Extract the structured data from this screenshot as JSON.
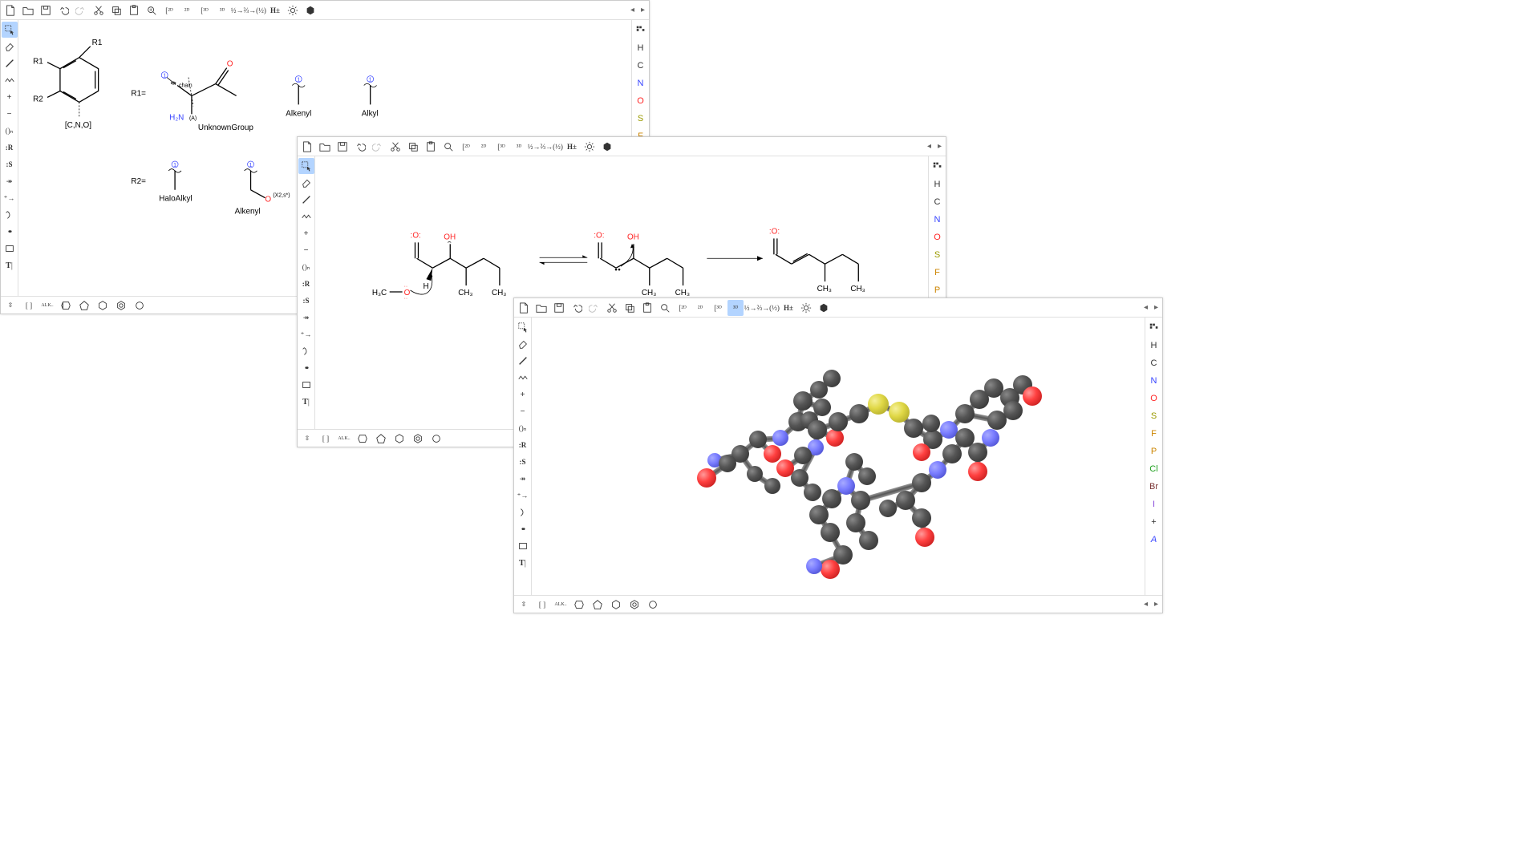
{
  "toolbar_top": {
    "new": "New",
    "open": "Open",
    "save": "Save",
    "undo": "Undo",
    "redo": "Redo",
    "cut": "Cut",
    "copy": "Copy",
    "paste": "Paste",
    "zoom_fit": "Zoom fit",
    "clean2d": "2D",
    "layout2d": "2D",
    "clean3d": "3D",
    "layout3d": "3D",
    "aromatize": "½→⅔",
    "dearomatize": "⅔→½",
    "hydrogens": "H±",
    "settings": "Settings",
    "help": "Help"
  },
  "toolbar_left": {
    "select": "Select",
    "erase": "Erase",
    "bond": "Bond",
    "chain": "Chain",
    "charge_plus": "+",
    "charge_minus": "-",
    "bracket": "()ₙ",
    "rgroup": ":R",
    "sgroup": "S",
    "arrow": "→",
    "plus": "+",
    "mapping": "↕",
    "pair": "••",
    "frame": "□",
    "text": "T|"
  },
  "elements": [
    "H",
    "C",
    "N",
    "O",
    "S",
    "F",
    "P",
    "Cl",
    "Br",
    "I",
    "+",
    "A"
  ],
  "bottom": {
    "expand": "expand",
    "bracket": "[ ]",
    "alk": "ALK",
    "benz": "benz",
    "pent": "pent",
    "hex": "hex",
    "hept": "hept",
    "cyclo": "cyclo"
  },
  "win1": {
    "r_labels": {
      "R1a": "R1",
      "R1b": "R1",
      "R2": "R2",
      "atom_query": "[C,N,O]"
    },
    "r1_eq": "R1=",
    "r2_eq": "R2=",
    "groups": {
      "unknown_nh2": "H₂N",
      "unknown_a": "(A)",
      "unknown_chain": "chain",
      "unknown_name": "UnknownGroup",
      "alkenyl": "Alkenyl",
      "alkyl": "Alkyl",
      "haloalkyl": "HaloAlkyl",
      "alkenyl2": "Alkenyl",
      "oxs": "(X2,s*)",
      "badge1": "1",
      "badge1b": "1",
      "badge1c": "1",
      "badge1d": "1",
      "badge1e": "1"
    }
  },
  "win2": {
    "labels": {
      "o1": ":O:",
      "oh1": "OH",
      "o2": ":O:",
      "oh2": "OH",
      "o3": ":O:",
      "ch3_a": "CH₃",
      "ch3_b": "CH₃",
      "ch3_c": "CH₃",
      "ch3_d": "CH₃",
      "ch3_e": "CH₃",
      "ch3_f": "CH₃",
      "h3co": "H₃C",
      "om": "O"
    }
  },
  "win3": {
    "mode": "3D"
  }
}
